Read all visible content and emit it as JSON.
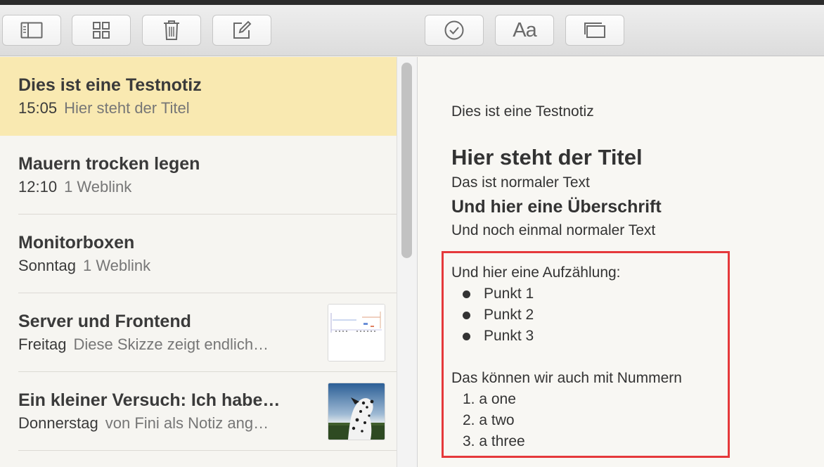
{
  "toolbar": {
    "buttons": [
      {
        "icon": "sidebar-toggle-icon"
      },
      {
        "icon": "grid-view-icon"
      },
      {
        "icon": "trash-icon"
      },
      {
        "icon": "compose-icon"
      },
      {
        "icon": "checklist-icon"
      },
      {
        "icon": "format-text-icon",
        "label": "Aa"
      },
      {
        "icon": "attachments-browser-icon"
      }
    ]
  },
  "notes": [
    {
      "title": "Dies ist eine Testnotiz",
      "date": "15:05",
      "snippet": "Hier steht der Titel",
      "selected": true
    },
    {
      "title": "Mauern trocken legen",
      "date": "12:10",
      "snippet": "1 Weblink"
    },
    {
      "title": "Monitorboxen",
      "date": "Sonntag",
      "snippet": "1 Weblink"
    },
    {
      "title": "Server und Frontend",
      "date": "Freitag",
      "snippet": "Diese Skizze zeigt endlich…",
      "thumbnail": "sketch-thumbnail"
    },
    {
      "title": "Ein kleiner Versuch: Ich habe…",
      "date": "Donnerstag",
      "snippet": "von Fini als Notiz ang…",
      "thumbnail": "dalmatian-photo-thumbnail"
    }
  ],
  "editor": {
    "first_line": "Dies ist eine Testnotiz",
    "title": "Hier steht der Titel",
    "paragraph1": "Das ist normaler Text",
    "heading": "Und hier eine Überschrift",
    "paragraph2": "Und noch einmal normaler Text",
    "list_intro": "Und hier eine Aufzählung:",
    "bullets": [
      "Punkt 1",
      "Punkt 2",
      "Punkt 3"
    ],
    "numbered_intro": "Das können wir auch mit Nummern",
    "numbered": [
      "1. a one",
      "2. a two",
      "3. a three"
    ]
  },
  "colors": {
    "selected_note": "#f9e9b1",
    "highlight_border": "#e5393b"
  }
}
